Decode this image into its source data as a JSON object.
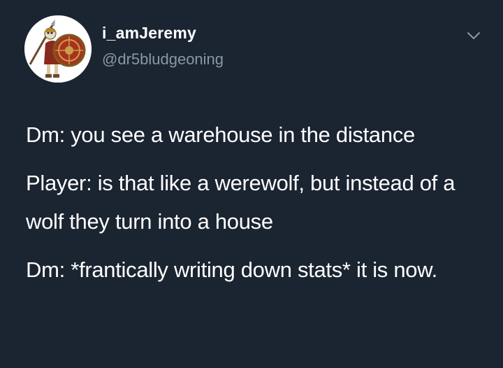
{
  "tweet": {
    "display_name": "i_amJeremy",
    "handle": "@dr5bludgeoning",
    "avatar_icon": "warrior-skeleton-avatar",
    "menu_icon": "chevron-down-icon",
    "paragraphs": [
      "Dm: you see a warehouse in the distance",
      "Player: is that like a werewolf, but instead of a wolf they turn into a house",
      "Dm: *frantically writing down stats* it is now."
    ]
  },
  "colors": {
    "background": "#1b2431",
    "text_primary": "#ffffff",
    "text_secondary": "#8b98a5"
  }
}
